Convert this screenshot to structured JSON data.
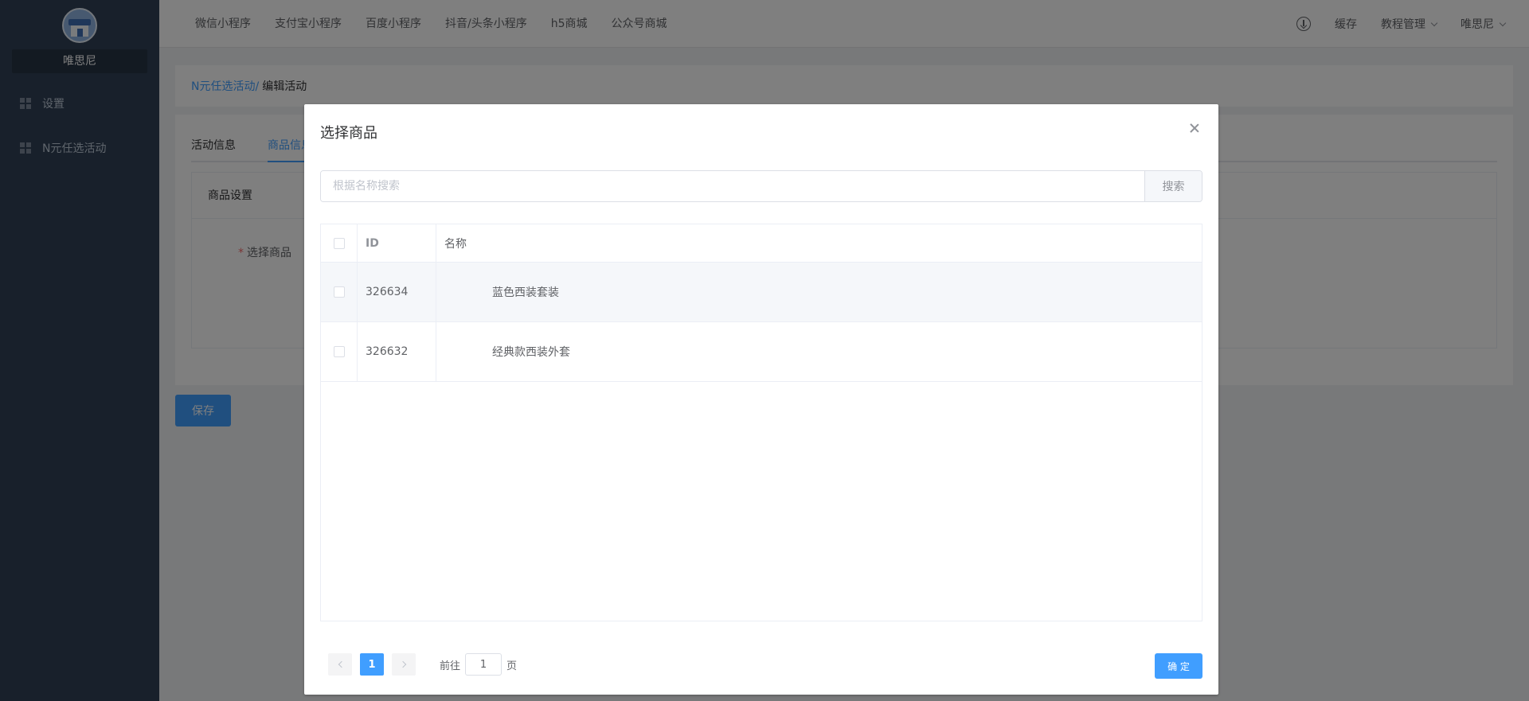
{
  "sidebar": {
    "brand_name": "唯思尼",
    "items": [
      {
        "label": "设置",
        "icon": "grid-icon"
      },
      {
        "label": "N元任选活动",
        "icon": "grid-icon"
      }
    ]
  },
  "topbar": {
    "tabs": [
      "微信小程序",
      "支付宝小程序",
      "百度小程序",
      "抖音/头条小程序",
      "h5商城",
      "公众号商城"
    ],
    "download_icon": "download-icon",
    "cache_label": "缓存",
    "tutorial_label": "教程管理",
    "user_label": "唯思尼"
  },
  "breadcrumb": {
    "parent": "N元任选活动/",
    "current": "编辑活动"
  },
  "page": {
    "tabs": [
      "活动信息",
      "商品信息"
    ],
    "section_title": "商品设置",
    "select_goods_label": "选择商品",
    "save_label": "保存"
  },
  "dialog": {
    "title": "选择商品",
    "search_placeholder": "根据名称搜索",
    "search_button": "搜索",
    "columns": {
      "id": "ID",
      "name": "名称"
    },
    "rows": [
      {
        "id": "326634",
        "name": "蓝色西装套装"
      },
      {
        "id": "326632",
        "name": "经典款西装外套"
      }
    ],
    "pagination": {
      "current_page": "1",
      "goto_prefix": "前往",
      "goto_value": "1",
      "goto_suffix": "页"
    },
    "confirm_label": "确 定"
  },
  "colors": {
    "primary": "#409eff",
    "sidebar": "#304156",
    "required": "#f56c6c"
  }
}
